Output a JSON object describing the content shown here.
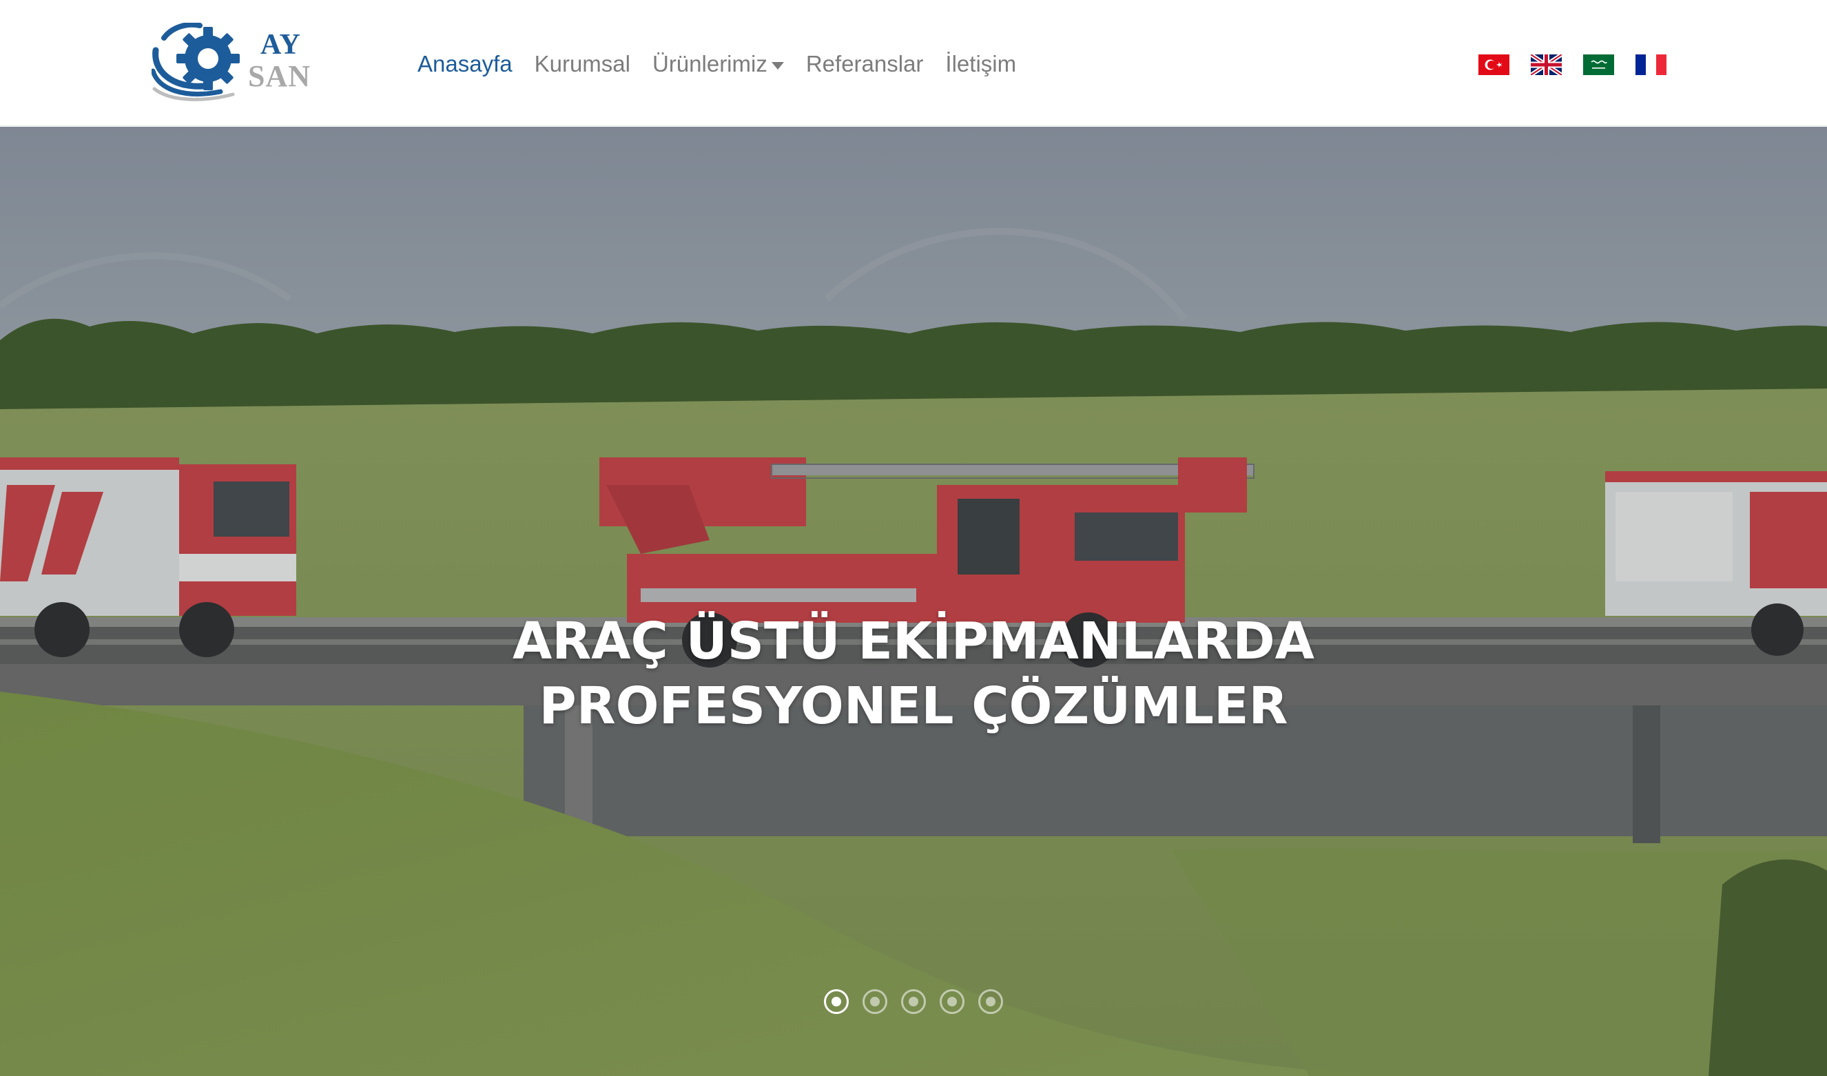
{
  "brand": {
    "line1": "AY",
    "line2": "SAN",
    "primary_color": "#1d5c9a",
    "secondary_color": "#a8a8a8"
  },
  "nav": {
    "items": [
      {
        "label": "Anasayfa",
        "active": true
      },
      {
        "label": "Kurumsal",
        "active": false
      },
      {
        "label": "Ürünlerimiz",
        "active": false,
        "dropdown": true
      },
      {
        "label": "Referanslar",
        "active": false
      },
      {
        "label": "İletişim",
        "active": false
      }
    ],
    "active_color": "#1d5c9a",
    "text_color": "#7c7c7c"
  },
  "languages": [
    {
      "icon": "turkey-flag-icon"
    },
    {
      "icon": "uk-flag-icon"
    },
    {
      "icon": "saudi-arabia-flag-icon"
    },
    {
      "icon": "france-flag-icon"
    }
  ],
  "hero": {
    "caption_line1": "ARAÇ ÜSTÜ EKİPMANLARDA",
    "caption_line2": "PROFESYONEL ÇÖZÜMLER",
    "slide_count": 5,
    "active_slide": 1
  }
}
